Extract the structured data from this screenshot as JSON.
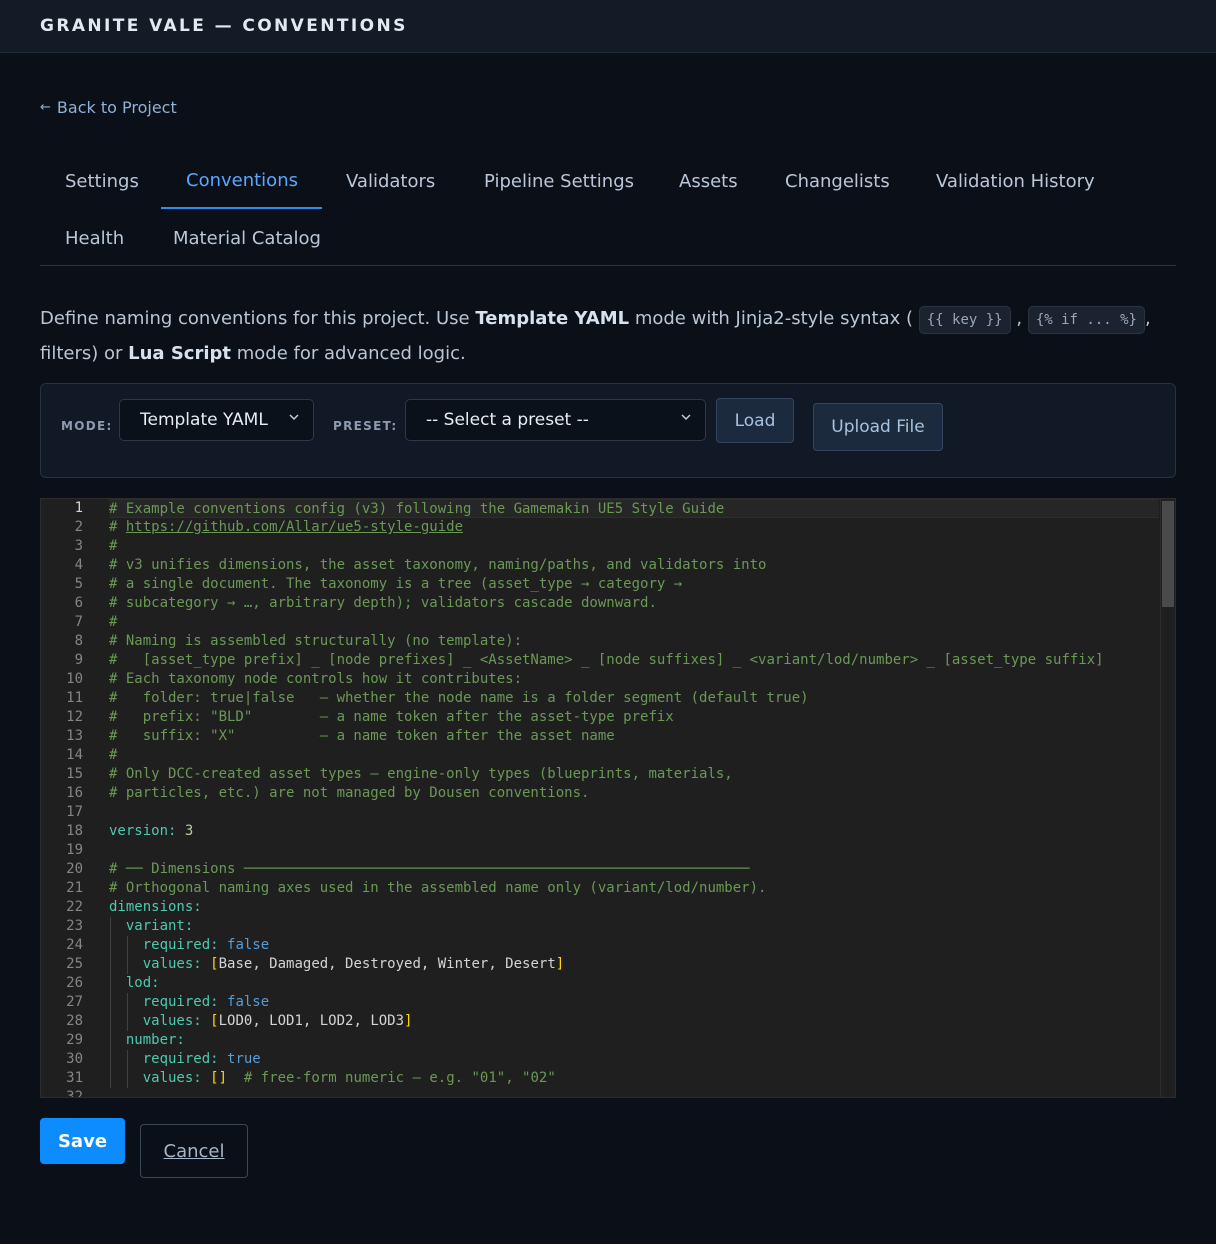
{
  "app": {
    "title": "GRANITE VALE — CONVENTIONS"
  },
  "nav": {
    "back_label": "Back to Project",
    "back_icon": "arrow-left-icon"
  },
  "tabs": [
    {
      "label": "Settings",
      "active": false
    },
    {
      "label": "Conventions",
      "active": true
    },
    {
      "label": "Validators",
      "active": false
    },
    {
      "label": "Pipeline Settings",
      "active": false
    },
    {
      "label": "Assets",
      "active": false
    },
    {
      "label": "Changelists",
      "active": false
    },
    {
      "label": "Validation History",
      "active": false
    },
    {
      "label": "Health",
      "active": false
    },
    {
      "label": "Material Catalog",
      "active": false
    }
  ],
  "intro": {
    "part1": "Define naming conventions for this project. Use ",
    "bold1": "Template YAML",
    "part2": " mode with Jinja2-style syntax (",
    "chip1": "{{ key }}",
    "sep": ",",
    "chip2": "{% if ... %}",
    "part3": ", filters) or ",
    "bold2": "Lua Script",
    "part4": " mode for advanced logic."
  },
  "toolbar": {
    "mode_label": "MODE:",
    "mode_value": "Template YAML",
    "preset_label": "PRESET:",
    "preset_value": "-- Select a preset --",
    "load_label": "Load",
    "upload_label": "Upload File"
  },
  "editor": {
    "current_line": 1,
    "lines": [
      "# Example conventions config (v3) following the Gamemakin UE5 Style Guide",
      "# https://github.com/Allar/ue5-style-guide",
      "#",
      "# v3 unifies dimensions, the asset taxonomy, naming/paths, and validators into",
      "# a single document. The taxonomy is a tree (asset_type → category →",
      "# subcategory → …, arbitrary depth); validators cascade downward.",
      "#",
      "# Naming is assembled structurally (no template):",
      "#   [asset_type prefix] _ [node prefixes] _ <AssetName> _ [node suffixes] _ <variant/lod/number> _ [asset_type suffix]",
      "# Each taxonomy node controls how it contributes:",
      "#   folder: true|false   — whether the node name is a folder segment (default true)",
      "#   prefix: \"BLD\"        — a name token after the asset-type prefix",
      "#   suffix: \"X\"          — a name token after the asset name",
      "#",
      "# Only DCC-created asset types — engine-only types (blueprints, materials,",
      "# particles, etc.) are not managed by Dousen conventions.",
      "",
      "version: 3",
      "",
      "# ── Dimensions ────────────────────────────────────────────────────────────",
      "# Orthogonal naming axes used in the assembled name only (variant/lod/number).",
      "dimensions:",
      "  variant:",
      "    required: false",
      "    values: [Base, Damaged, Destroyed, Winter, Desert]",
      "  lod:",
      "    required: false",
      "    values: [LOD0, LOD1, LOD2, LOD3]",
      "  number:",
      "    required: true",
      "    values: []  # free-form numeric — e.g. \"01\", \"02\"",
      ""
    ]
  },
  "actions": {
    "save_label": "Save",
    "cancel_label": "Cancel"
  },
  "colors": {
    "accent": "#0d8cff",
    "tab_active": "#58a8ff",
    "comment": "#6a9955",
    "key": "#4ec9b0",
    "number": "#b5cea8",
    "boolean": "#569cd6",
    "bracket": "#ffd700"
  }
}
